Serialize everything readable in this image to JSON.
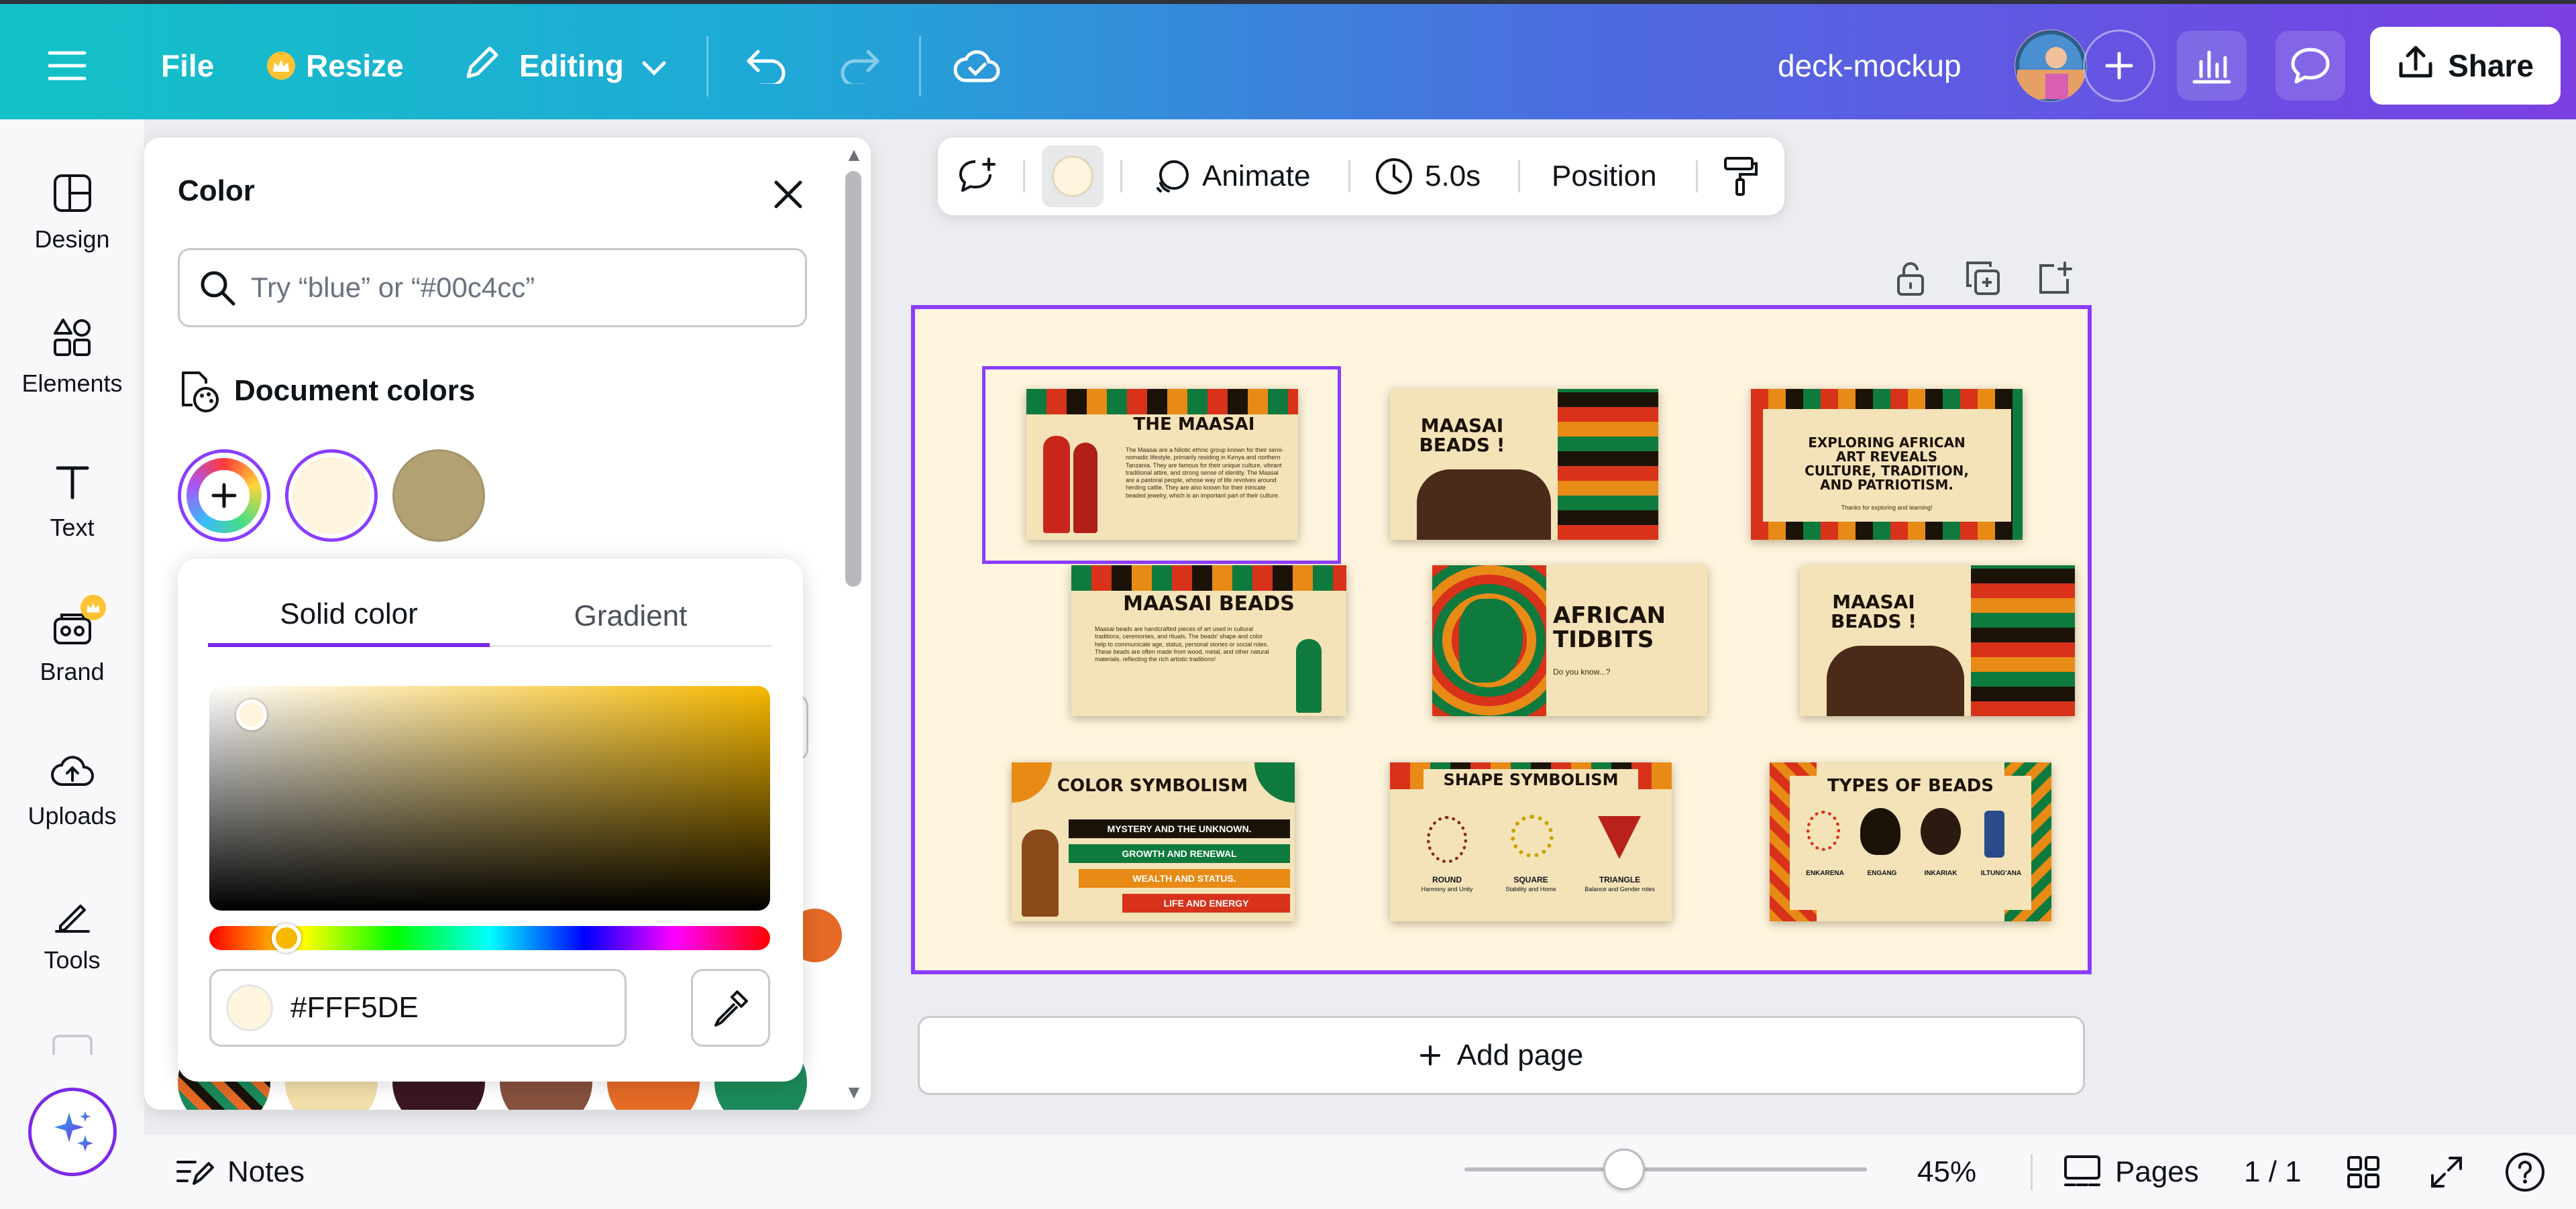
{
  "topbar": {
    "file_label": "File",
    "resize_label": "Resize",
    "editing_label": "Editing",
    "doc_title": "deck-mockup",
    "share_label": "Share"
  },
  "rail": {
    "items": [
      {
        "label": "Design",
        "icon": "design-icon"
      },
      {
        "label": "Elements",
        "icon": "elements-icon"
      },
      {
        "label": "Text",
        "icon": "text-icon"
      },
      {
        "label": "Brand",
        "icon": "brand-icon"
      },
      {
        "label": "Uploads",
        "icon": "uploads-icon"
      },
      {
        "label": "Tools",
        "icon": "tools-icon"
      }
    ]
  },
  "color_panel": {
    "title": "Color",
    "search_placeholder": "Try “blue” or “#00c4cc”",
    "document_colors_label": "Document colors",
    "document_colors": [
      "#fff5de",
      "#b2a173"
    ],
    "bottom_colors": [
      "#f1deaa",
      "#3a1620",
      "#86513f",
      "#e46a25",
      "#1b8a5a"
    ]
  },
  "picker": {
    "tab_solid": "Solid color",
    "tab_gradient": "Gradient",
    "hex_value": "#FFF5DE",
    "current_color": "#fff5de"
  },
  "element_toolbar": {
    "animate_label": "Animate",
    "duration_label": "5.0s",
    "position_label": "Position"
  },
  "slides": [
    {
      "title": "THE MAASAI",
      "body": "The Maasai are a Nilotic ethnic group known for their semi-nomadic lifestyle, primarily residing in Kenya and northern Tanzania. They are famous for their unique culture, vibrant traditional attire, and strong sense of identity. The Maasai are a pastoral people, whose way of life revolves around herding cattle. They are also known for their intricate beaded jewelry, which is an important part of their culture."
    },
    {
      "title": "MAASAI BEADS !",
      "body": ""
    },
    {
      "title": "EXPLORING AFRICAN ART REVEALS CULTURE, TRADITION, AND PATRIOTISM.",
      "body": "Thanks for exploring and learning!"
    },
    {
      "title": "MAASAI BEADS",
      "body": "Maasai beads are handcrafted pieces of art used in cultural traditions, ceremonies, and rituals. The beads' shape and color help to communicate age, status, personal stories or social roles. These beads are often made from wood, metal, and other natural materials, reflecting the rich artistic traditions!"
    },
    {
      "title": "AFRICAN TIDBITS",
      "body": "Do you know...?"
    },
    {
      "title": "MAASAI BEADS !",
      "body": ""
    },
    {
      "title": "COLOR SYMBOLISM",
      "bars": [
        "MYSTERY AND THE UNKNOWN.",
        "GROWTH AND RENEWAL",
        "WEALTH AND STATUS.",
        "LIFE AND ENERGY"
      ]
    },
    {
      "title": "SHAPE SYMBOLISM",
      "shapes": [
        {
          "name": "ROUND",
          "desc": "Harmony and Unity"
        },
        {
          "name": "SQUARE",
          "desc": "Stability and Home"
        },
        {
          "name": "TRIANGLE",
          "desc": "Balance and Gender roles"
        }
      ]
    },
    {
      "title": "TYPES OF BEADS",
      "types": [
        "ENKARENA",
        "ENGANG",
        "INKARIAK",
        "ILTUNG'ANA"
      ]
    }
  ],
  "canvas": {
    "background": "#fff5de",
    "add_page_label": "Add page"
  },
  "bottombar": {
    "notes_label": "Notes",
    "zoom_percent": 45,
    "zoom_label": "45%",
    "pages_label": "Pages",
    "page_counter": "1 / 1"
  },
  "colors": {
    "accent": "#8b3dff",
    "share_bg": "#ffffff"
  }
}
